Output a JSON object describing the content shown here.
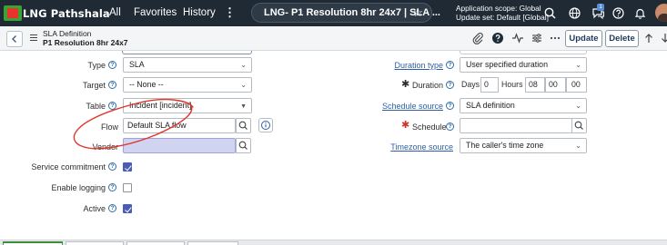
{
  "brand": {
    "logo_text": "LNG Pathshala"
  },
  "topnav": {
    "all": "All",
    "favorites": "Favorites",
    "history": "History",
    "more": "⋮",
    "record_title": "LNG- P1 Resolution 8hr 24x7 | SLA ...",
    "scope_line1": "Application scope: Global",
    "scope_line2": "Update set: Default [Global]",
    "notification_count": "1"
  },
  "form_header": {
    "table_name": "SLA Definition",
    "record_name": "P1 Resolution 8hr 24x7",
    "update_label": "Update",
    "delete_label": "Delete"
  },
  "left": {
    "type": {
      "label": "Type",
      "value": "SLA"
    },
    "target": {
      "label": "Target",
      "value": "-- None --"
    },
    "table": {
      "label": "Table",
      "value": "Incident [incident]"
    },
    "flow": {
      "label": "Flow",
      "value": "Default SLA flow"
    },
    "vendor": {
      "label": "Vendor",
      "value": ""
    },
    "service_commitment": {
      "label": "Service commitment",
      "checked": true
    },
    "enable_logging": {
      "label": "Enable logging",
      "checked": false
    },
    "active": {
      "label": "Active",
      "checked": true
    }
  },
  "right": {
    "duration_type": {
      "label": "Duration type",
      "value": "User specified duration"
    },
    "duration": {
      "label": "Duration",
      "days_label": "Days",
      "days": "0",
      "hours_label": "Hours",
      "hours": "08",
      "minutes": "00",
      "seconds": "00"
    },
    "schedule_source": {
      "label": "Schedule source",
      "value": "SLA definition"
    },
    "schedule": {
      "label": "Schedule",
      "value": ""
    },
    "timezone_source": {
      "label": "Timezone source",
      "value": "The caller's time zone"
    }
  },
  "annotation": {
    "color": "#e0352b"
  },
  "colors": {
    "nav_bg": "#1f2a35",
    "checkbox": "#4a5cb8",
    "link": "#2d5fa8"
  }
}
